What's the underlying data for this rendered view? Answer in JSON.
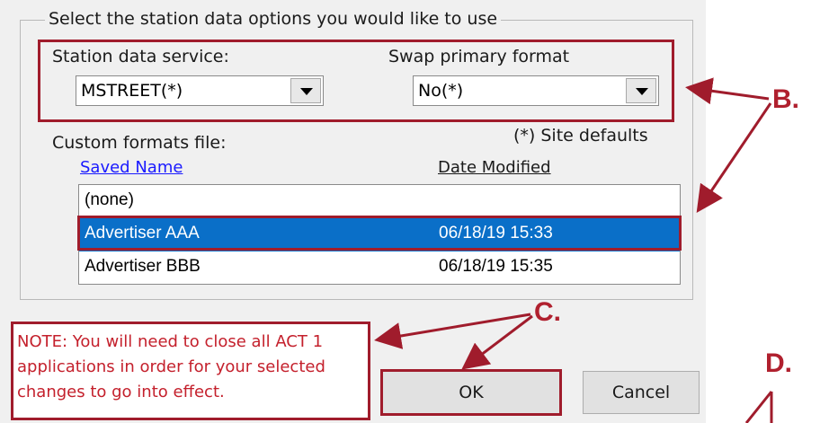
{
  "group": {
    "legend": "Select the station data options you would like to use"
  },
  "station_service": {
    "label": "Station data service:",
    "value": "MSTREET(*)"
  },
  "swap_format": {
    "label": "Swap primary format",
    "value": "No(*)"
  },
  "site_defaults": "(*) Site defaults",
  "custom_formats": {
    "label": "Custom formats file:",
    "columns": [
      "Saved Name",
      "Date Modified"
    ],
    "rows": [
      {
        "name": "(none)",
        "date": ""
      },
      {
        "name": "Advertiser AAA",
        "date": "06/18/19 15:33"
      },
      {
        "name": "Advertiser BBB",
        "date": "06/18/19 15:35"
      }
    ],
    "selected_index": 1
  },
  "note": "NOTE: You will need to close all ACT 1 applications in order for your selected changes to go into effect.",
  "buttons": {
    "ok": "OK",
    "cancel": "Cancel"
  },
  "callouts": {
    "b": "B.",
    "c": "C.",
    "d": "D."
  },
  "colors": {
    "annotation_red": "#a01c2c",
    "selection_blue": "#0a6fc8",
    "link_blue": "#1a1aff"
  }
}
